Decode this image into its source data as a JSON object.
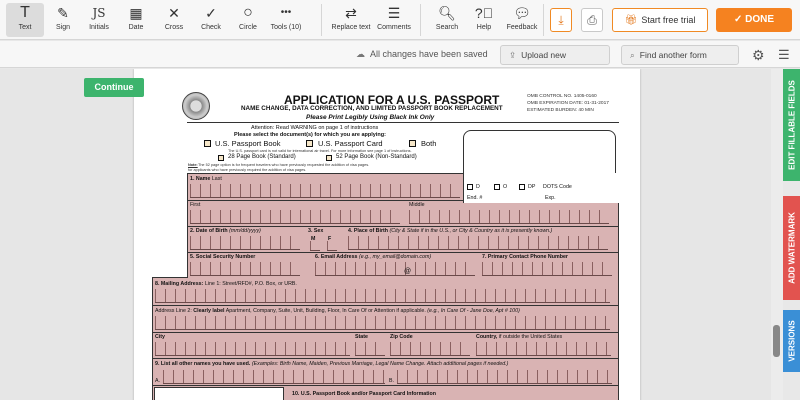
{
  "toolbar": {
    "tools": [
      {
        "label": "Text",
        "icon": "T"
      },
      {
        "label": "Sign",
        "icon": "✎"
      },
      {
        "label": "Initials",
        "icon": "JS"
      },
      {
        "label": "Date",
        "icon": "▦"
      },
      {
        "label": "Cross",
        "icon": "✕"
      },
      {
        "label": "Check",
        "icon": "✓"
      },
      {
        "label": "Circle",
        "icon": "○"
      },
      {
        "label": "Tools (10)",
        "icon": "•••"
      }
    ],
    "replace_text_label": "Replace text",
    "comments_label": "Comments",
    "search_label": "Search",
    "help_label": "Help",
    "feedback_label": "Feedback",
    "trial_label": "Start free trial",
    "done_label": "DONE",
    "accent_color": "#f58220"
  },
  "subbar": {
    "saved_status": "All changes have been saved",
    "upload_label": "Upload new document",
    "find_label": "Find another form"
  },
  "continue_label": "Continue",
  "side_tabs": {
    "edit_fields": "EDIT FILLABLE FIELDS",
    "watermark": "ADD WATERMARK",
    "versions": "VERSIONS"
  },
  "form": {
    "title": "APPLICATION FOR A U.S. PASSPORT",
    "subtitle": "NAME CHANGE, DATA CORRECTION, AND LIMITED PASSPORT BOOK REPLACEMENT",
    "print_note": "Please Print Legibly Using Black Ink Only",
    "omb_control": "OMB CONTROL NO. 1405-0160",
    "omb_expiration": "OMB EXPIRATION DATE:  01-31-2017",
    "omb_burden": "ESTIMATED BURDEN: 40 MIN",
    "attention": "Attention: Read WARNING on page 1 of instructions",
    "select_docs": "Please select the document(s) for which you are applying:",
    "opt_book": "U.S. Passport Book",
    "opt_card": "U.S. Passport Card",
    "opt_both": "Both",
    "card_note": "The U.S. passport card is not valid for international air travel. For more information see page 1 of instructions.",
    "opt_28": "28 Page Book (Standard)",
    "opt_52": "52 Page Book (Non-Standard)",
    "note_label": "Note:",
    "note_text": "The 52 page option is for frequent travelers who have previously requested the addition of visa pages.",
    "note_text2": "for applicants who have previously required the addition of visa pages.",
    "f1_num": "1.",
    "f1_name": "Name",
    "f1_last": "Last",
    "f1_first": "First",
    "f1_middle": "Middle",
    "office_d": "D",
    "office_o": "O",
    "office_dp": "DP",
    "office_dots": "DOTS Code",
    "office_end": "End. #",
    "office_exp": "Exp.",
    "f2": "2.  Date of Birth",
    "f2_hint": "(mm/dd/yyyy)",
    "f3": "3.  Sex",
    "f3_m": "M",
    "f3_f": "F",
    "f4": "4.  Place of Birth",
    "f4_hint": "(City & State if in the U.S., or City & Country as it is presently known.)",
    "f5": "5.  Social Security Number",
    "f6": "6.  Email Address",
    "f6_hint": "(e.g., my_email@domain.com)",
    "f6_at": "@",
    "f7": "7. Primary Contact Phone Number",
    "f8": "8.  Mailing Address:",
    "f8_hint": "Line 1: Street/RFD#, P.O. Box, or URB.",
    "f8_line2": "Address Line 2:",
    "f8_line2_bold": "Clearly label",
    "f8_line2_hint": "Apartment, Company, Suite, Unit, Building, Floor, In Care Of or Attention if applicable.",
    "f8_line2_eg": "(e.g., In Care Of - Jane Doe, Apt # 100)",
    "f_city": "City",
    "f_state": "State",
    "f_zip": "Zip Code",
    "f_country": "Country,",
    "f_country_hint": "if outside the United States",
    "f9": "9.  List all other names you have used.",
    "f9_hint": "(Examples: Birth Name, Maiden, Previous Marriage, Legal Name Change.  Attach additional  pages if needed.)",
    "f9_a": "A.",
    "f9_b": "B.",
    "f10": "10. U.S. Passport Book and/or Passport Card Information"
  }
}
